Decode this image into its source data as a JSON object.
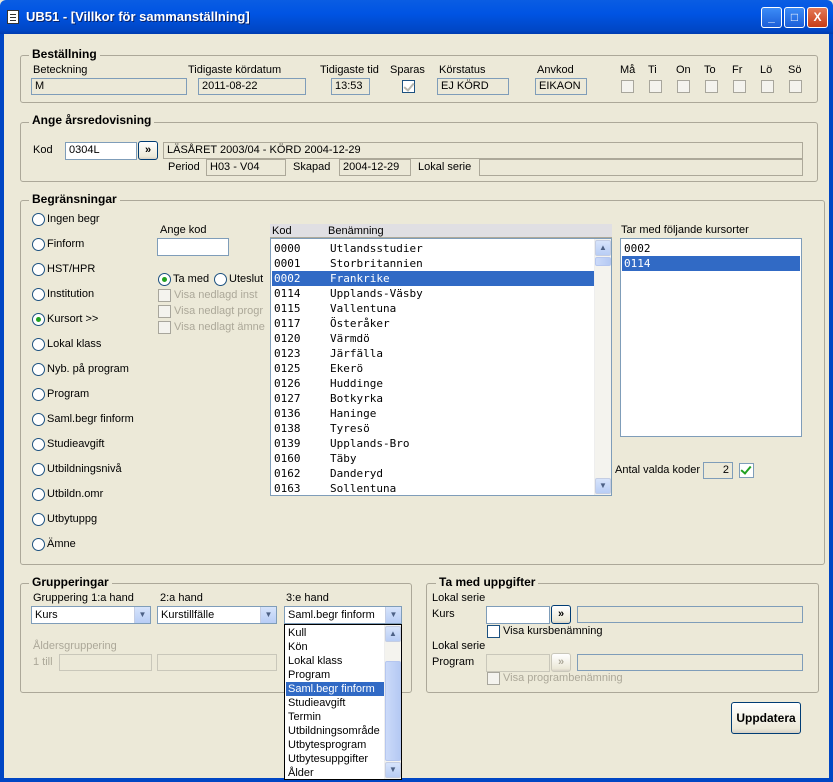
{
  "window": {
    "title": "UB51 - [Villkor för sammanställning]",
    "minimize": "_",
    "maximize": "□",
    "close": "X"
  },
  "bestallning": {
    "heading": "Beställning",
    "labels": {
      "beteckning": "Beteckning",
      "tidigaste_kordatum": "Tidigaste kördatum",
      "tidigaste_tid": "Tidigaste tid",
      "sparas": "Sparas",
      "korstatus": "Körstatus",
      "anvkod": "Anvkod"
    },
    "values": {
      "beteckning": "M",
      "tidigaste_kordatum": "2011-08-22",
      "tidigaste_tid": "13:53",
      "sparas": true,
      "korstatus": "EJ KÖRD",
      "anvkod": "EIKAON"
    },
    "days": [
      "Må",
      "Ti",
      "On",
      "To",
      "Fr",
      "Lö",
      "Sö"
    ]
  },
  "arsredovisning": {
    "heading": "Ange årsredovisning",
    "kod_label": "Kod",
    "kod_value": "0304L",
    "lookup_button": "»",
    "description": "LÄSÅRET 2003/04 - KÖRD 2004-12-29",
    "period_label": "Period",
    "period_value": "H03 - V04",
    "skapad_label": "Skapad",
    "skapad_value": "2004-12-29",
    "lokal_serie_label": "Lokal serie",
    "lokal_serie_value": ""
  },
  "begransningar": {
    "heading": "Begränsningar",
    "options": [
      "Ingen begr",
      "Finform",
      "HST/HPR",
      "Institution",
      "Kursort >>",
      "Lokal klass",
      "Nyb. på program",
      "Program",
      "Saml.begr finform",
      "Studieavgift",
      "Utbildningsnivå",
      "Utbildn.omr",
      "Utbytuppg",
      "Ämne"
    ],
    "selected_option": "Kursort >>",
    "ange_kod_label": "Ange kod",
    "ange_kod_value": "",
    "ta_med_label": "Ta med",
    "uteslut_label": "Uteslut",
    "visa_inst": "Visa nedlagd inst",
    "visa_progr": "Visa nedlagt progr",
    "visa_amne": "Visa nedlagt ämne",
    "col_kod": "Kod",
    "col_benamning": "Benämning",
    "codes": [
      {
        "kod": "0000",
        "namn": "Utlandsstudier"
      },
      {
        "kod": "0001",
        "namn": "Storbritannien"
      },
      {
        "kod": "0002",
        "namn": "Frankrike"
      },
      {
        "kod": "0114",
        "namn": "Upplands-Väsby"
      },
      {
        "kod": "0115",
        "namn": "Vallentuna"
      },
      {
        "kod": "0117",
        "namn": "Österåker"
      },
      {
        "kod": "0120",
        "namn": "Värmdö"
      },
      {
        "kod": "0123",
        "namn": "Järfälla"
      },
      {
        "kod": "0125",
        "namn": "Ekerö"
      },
      {
        "kod": "0126",
        "namn": "Huddinge"
      },
      {
        "kod": "0127",
        "namn": "Botkyrka"
      },
      {
        "kod": "0136",
        "namn": "Haninge"
      },
      {
        "kod": "0138",
        "namn": "Tyresö"
      },
      {
        "kod": "0139",
        "namn": "Upplands-Bro"
      },
      {
        "kod": "0160",
        "namn": "Täby"
      },
      {
        "kod": "0162",
        "namn": "Danderyd"
      },
      {
        "kod": "0163",
        "namn": "Sollentuna"
      }
    ],
    "selected_code": "0002",
    "tar_med_label": "Tar med följande kursorter",
    "tar_med": [
      "0002",
      "0114"
    ],
    "tar_med_selected": "0114",
    "antal_label": "Antal valda koder",
    "antal_value": "2"
  },
  "grupperingar": {
    "heading": "Grupperingar",
    "hand1_label": "Gruppering 1:a hand",
    "hand1_value": "Kurs",
    "hand2_label": "2:a hand",
    "hand2_value": "Kurstillfälle",
    "hand3_label": "3:e hand",
    "hand3_value": "Saml.begr finform",
    "aldersgruppering_label": "Åldersgruppering",
    "till_label": "1 till",
    "dropdown_items": [
      "Kull",
      "Kön",
      "Lokal klass",
      "Program",
      "Saml.begr finform",
      "Studieavgift",
      "Termin",
      "Utbildningsområde",
      "Utbytesprogram",
      "Utbytesuppgifter",
      "Ålder"
    ],
    "dropdown_selected": "Saml.begr finform"
  },
  "ta_med_uppgifter": {
    "heading": "Ta med uppgifter",
    "lokal_serie1": "Lokal serie",
    "kurs_label": "Kurs",
    "visa_kursbenamning": "Visa kursbenämning",
    "lokal_serie2": "Lokal serie",
    "program_label": "Program",
    "visa_programbenamning": "Visa programbenämning",
    "lookup_button": "»"
  },
  "uppdatera_button": "Uppdatera"
}
